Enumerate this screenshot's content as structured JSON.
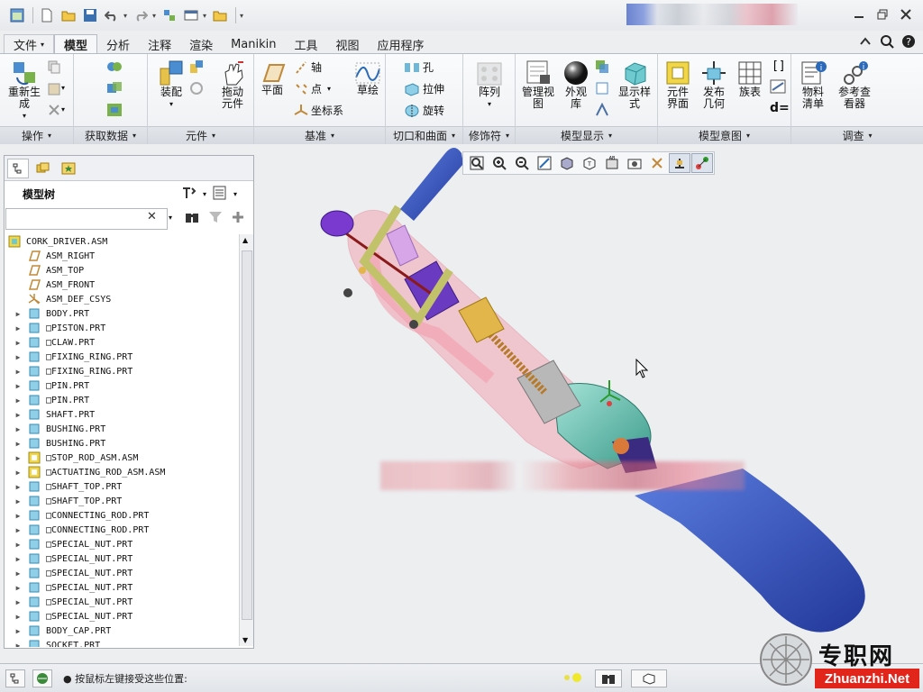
{
  "quick_access": {
    "icons": [
      "window-icon",
      "new-icon",
      "open-icon",
      "save-icon",
      "undo-icon",
      "redo-icon",
      "regenerate-icon",
      "windows-icon",
      "close-window-icon",
      "customize-icon"
    ]
  },
  "tabs": [
    {
      "label": "文件",
      "dd": "▾"
    },
    {
      "label": "模型"
    },
    {
      "label": "分析"
    },
    {
      "label": "注释"
    },
    {
      "label": "渲染"
    },
    {
      "label": "Manikin"
    },
    {
      "label": "工具"
    },
    {
      "label": "视图"
    },
    {
      "label": "应用程序"
    }
  ],
  "ribbon": {
    "operations": {
      "label": "操作",
      "regenerate": "重新生成"
    },
    "get_data": {
      "label": "获取数据"
    },
    "component": {
      "label": "元件",
      "assemble": "装配",
      "drag": "拖动元件"
    },
    "datum": {
      "label": "基准",
      "plane": "平面",
      "axis": "轴",
      "point": "点",
      "csys": "坐标系",
      "sketch": "草绘"
    },
    "cut_surface": {
      "label": "切口和曲面",
      "hole": "孔",
      "extrude": "拉伸",
      "revolve": "旋转"
    },
    "modifier": {
      "label": "修饰符",
      "pattern": "阵列"
    },
    "model_display": {
      "label": "模型显示",
      "manage_views": "管理视图",
      "appearance": "外观库",
      "display_style": "显示样式"
    },
    "model_intent": {
      "label": "模型意图",
      "component_interface": "元件界面",
      "publish_geometry": "发布几何",
      "family_table": "族表",
      "relations": "d="
    },
    "investigate": {
      "label": "调查",
      "bom": "物料清单",
      "ref_viewer": "参考查看器"
    }
  },
  "model_tree": {
    "title": "模型树",
    "search_placeholder": "",
    "items": [
      {
        "label": "CORK_DRIVER.ASM",
        "type": "asm-root",
        "exp": ""
      },
      {
        "label": "ASM_RIGHT",
        "type": "plane",
        "exp": ""
      },
      {
        "label": "ASM_TOP",
        "type": "plane",
        "exp": ""
      },
      {
        "label": "ASM_FRONT",
        "type": "plane",
        "exp": ""
      },
      {
        "label": "ASM_DEF_CSYS",
        "type": "csys",
        "exp": ""
      },
      {
        "label": "BODY.PRT",
        "type": "part",
        "exp": "▶"
      },
      {
        "label": "□PISTON.PRT",
        "type": "part",
        "exp": "▶"
      },
      {
        "label": "□CLAW.PRT",
        "type": "part",
        "exp": "▶"
      },
      {
        "label": "□FIXING_RING.PRT",
        "type": "part",
        "exp": "▶"
      },
      {
        "label": "□FIXING_RING.PRT",
        "type": "part",
        "exp": "▶"
      },
      {
        "label": "□PIN.PRT",
        "type": "part",
        "exp": "▶"
      },
      {
        "label": "□PIN.PRT",
        "type": "part",
        "exp": "▶"
      },
      {
        "label": "SHAFT.PRT",
        "type": "part",
        "exp": "▶"
      },
      {
        "label": "BUSHING.PRT",
        "type": "part",
        "exp": "▶"
      },
      {
        "label": "BUSHING.PRT",
        "type": "part",
        "exp": "▶"
      },
      {
        "label": "□STOP_ROD_ASM.ASM",
        "type": "asm",
        "exp": "▶"
      },
      {
        "label": "□ACTUATING_ROD_ASM.ASM",
        "type": "asm",
        "exp": "▶"
      },
      {
        "label": "□SHAFT_TOP.PRT",
        "type": "part",
        "exp": "▶"
      },
      {
        "label": "□SHAFT_TOP.PRT",
        "type": "part",
        "exp": "▶"
      },
      {
        "label": "□CONNECTING_ROD.PRT",
        "type": "part",
        "exp": "▶"
      },
      {
        "label": "□CONNECTING_ROD.PRT",
        "type": "part",
        "exp": "▶"
      },
      {
        "label": "□SPECIAL_NUT.PRT",
        "type": "part",
        "exp": "▶"
      },
      {
        "label": "□SPECIAL_NUT.PRT",
        "type": "part",
        "exp": "▶"
      },
      {
        "label": "□SPECIAL_NUT.PRT",
        "type": "part",
        "exp": "▶"
      },
      {
        "label": "□SPECIAL_NUT.PRT",
        "type": "part",
        "exp": "▶"
      },
      {
        "label": "□SPECIAL_NUT.PRT",
        "type": "part",
        "exp": "▶"
      },
      {
        "label": "□SPECIAL_NUT.PRT",
        "type": "part",
        "exp": "▶"
      },
      {
        "label": "BODY_CAP.PRT",
        "type": "part",
        "exp": "▶"
      },
      {
        "label": "SOCKET.PRT",
        "type": "part",
        "exp": "▶"
      }
    ]
  },
  "status": {
    "message": "● 按鼠标左键接受这些位置:"
  },
  "watermark": {
    "text": "专职网",
    "url": "Zhuanzhi.Net"
  },
  "colors": {
    "accent": "#3a78c2",
    "watermark_red": "#e1251b"
  }
}
